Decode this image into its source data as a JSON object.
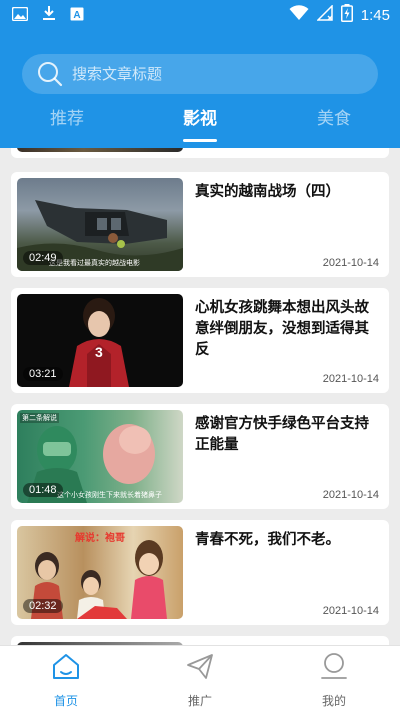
{
  "status_bar": {
    "time": "1:45"
  },
  "search": {
    "placeholder": "搜索文章标题"
  },
  "tabs": [
    {
      "label": "推荐",
      "active": false
    },
    {
      "label": "影视",
      "active": true
    },
    {
      "label": "美食",
      "active": false
    }
  ],
  "articles": [
    {
      "title": "真实的越南战场（四）",
      "duration": "02:49",
      "date": "2021-10-14",
      "caption": "这是我看过最真实的越战电影"
    },
    {
      "title": "心机女孩跳舞本想出风头故意绊倒朋友，没想到适得其反",
      "duration": "03:21",
      "date": "2021-10-14",
      "overlay": "3"
    },
    {
      "title": "感谢官方快手绿色平台支持正能量",
      "duration": "01:48",
      "date": "2021-10-14",
      "caption": "这个小女孩刚生下来就长着猪鼻子",
      "corner_label": "第二条解说"
    },
    {
      "title": "青春不死，我们不老。",
      "duration": "02:32",
      "date": "2021-10-14",
      "banner": "解说：袍哥"
    }
  ],
  "bottom_nav": [
    {
      "label": "首页",
      "icon": "home-icon",
      "active": true
    },
    {
      "label": "推广",
      "icon": "send-icon",
      "active": false
    },
    {
      "label": "我的",
      "icon": "profile-icon",
      "active": false
    }
  ],
  "colors": {
    "primary": "#1f93e6",
    "background": "#ececec",
    "card": "#ffffff"
  }
}
